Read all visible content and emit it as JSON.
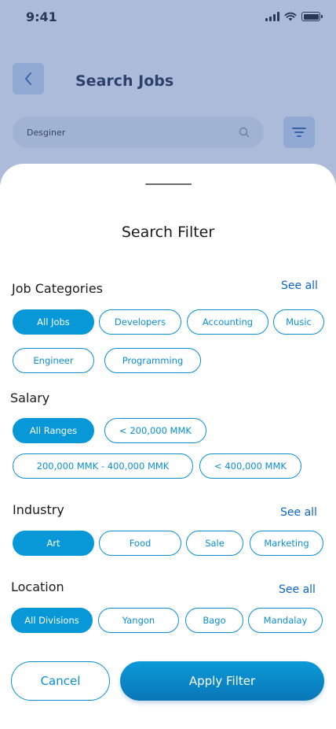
{
  "status_bar": {
    "time": "9:41"
  },
  "header": {
    "title": "Search Jobs"
  },
  "search": {
    "value": "Desginer"
  },
  "sheet": {
    "title": "Search Filter",
    "sections": {
      "job_categories": {
        "label": "Job Categories",
        "see_all": "See all",
        "chips": [
          "All Jobs",
          "Developers",
          "Accounting",
          "Music",
          "Engineer",
          "Programming"
        ],
        "selected": "All Jobs"
      },
      "salary": {
        "label": "Salary",
        "chips": [
          "All Ranges",
          "< 200,000 MMK",
          "200,000 MMK - 400,000 MMK",
          "< 400,000 MMK"
        ],
        "selected": "All Ranges"
      },
      "industry": {
        "label": "Industry",
        "see_all": "See all",
        "chips": [
          "Art",
          "Food",
          "Sale",
          "Marketing"
        ],
        "selected": "Art"
      },
      "location": {
        "label": "Location",
        "see_all": "See all",
        "chips": [
          "All Divisions",
          "Yangon",
          "Bago",
          "Mandalay"
        ],
        "selected": "All Divisions"
      }
    },
    "actions": {
      "cancel": "Cancel",
      "apply": "Apply Filter"
    }
  },
  "colors": {
    "accent": "#0898d8",
    "link": "#0a67c3",
    "overlay": "#4868aa"
  }
}
